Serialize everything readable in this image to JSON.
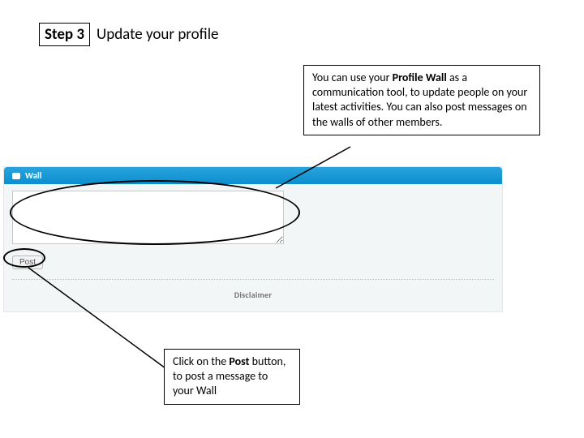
{
  "header": {
    "step_label": "Step 3",
    "title": "Update your profile"
  },
  "callouts": {
    "top_pre": "You can use your ",
    "top_bold": "Profile Wall",
    "top_post": " as a communication tool, to update people on your latest activities. You can also post messages on the walls of other members.",
    "bottom_pre": "Click on the ",
    "bottom_bold": "Post",
    "bottom_post": " button, to post a message to your Wall"
  },
  "app": {
    "wall_title": "Wall",
    "post_label": "Post",
    "disclaimer_label": "Disclaimer",
    "textarea_value": ""
  }
}
